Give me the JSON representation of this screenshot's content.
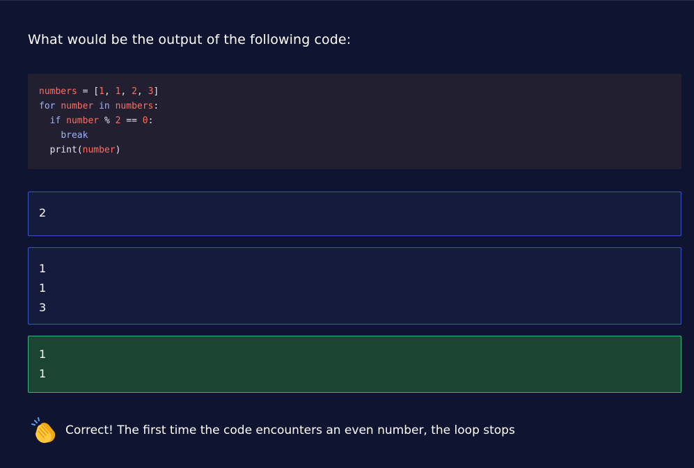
{
  "question": {
    "text": "What would be the output of the following code:"
  },
  "code": {
    "line1": {
      "v": "numbers",
      "eq": " = ",
      "lb": "[",
      "n1": "1",
      "c1": ", ",
      "n2": "1",
      "c2": ", ",
      "n3": "2",
      "c3": ", ",
      "n4": "3",
      "rb": "]"
    },
    "line2": {
      "kw1": "for",
      "v1": "number",
      "kw2": "in",
      "v2": "numbers",
      "colon": ":"
    },
    "line3": {
      "kw": "if",
      "v": "number",
      "op": "%",
      "n": "2",
      "eq": "==",
      "n0": "0",
      "colon": ":"
    },
    "line4": {
      "kw": "break"
    },
    "line5": {
      "fn": "print",
      "lp": "(",
      "v": "number",
      "rp": ")"
    }
  },
  "options": [
    {
      "lines": [
        "2"
      ],
      "state": "default"
    },
    {
      "lines": [
        "1",
        "1",
        "3"
      ],
      "state": "default"
    },
    {
      "lines": [
        "1",
        "1"
      ],
      "state": "correct"
    }
  ],
  "feedback": {
    "icon": "clapping-hands-icon",
    "text": "Correct! The first time the code encounters an even number, the loop stops"
  },
  "colors": {
    "background": "#0f1430",
    "code_background": "#211f30",
    "option_border": "#3b55c7",
    "option_background": "#141b3d",
    "correct_background": "#1a4433",
    "correct_border": "#3bb37a",
    "code_variable": "#ff6f61",
    "code_keyword": "#9fb4ff"
  }
}
